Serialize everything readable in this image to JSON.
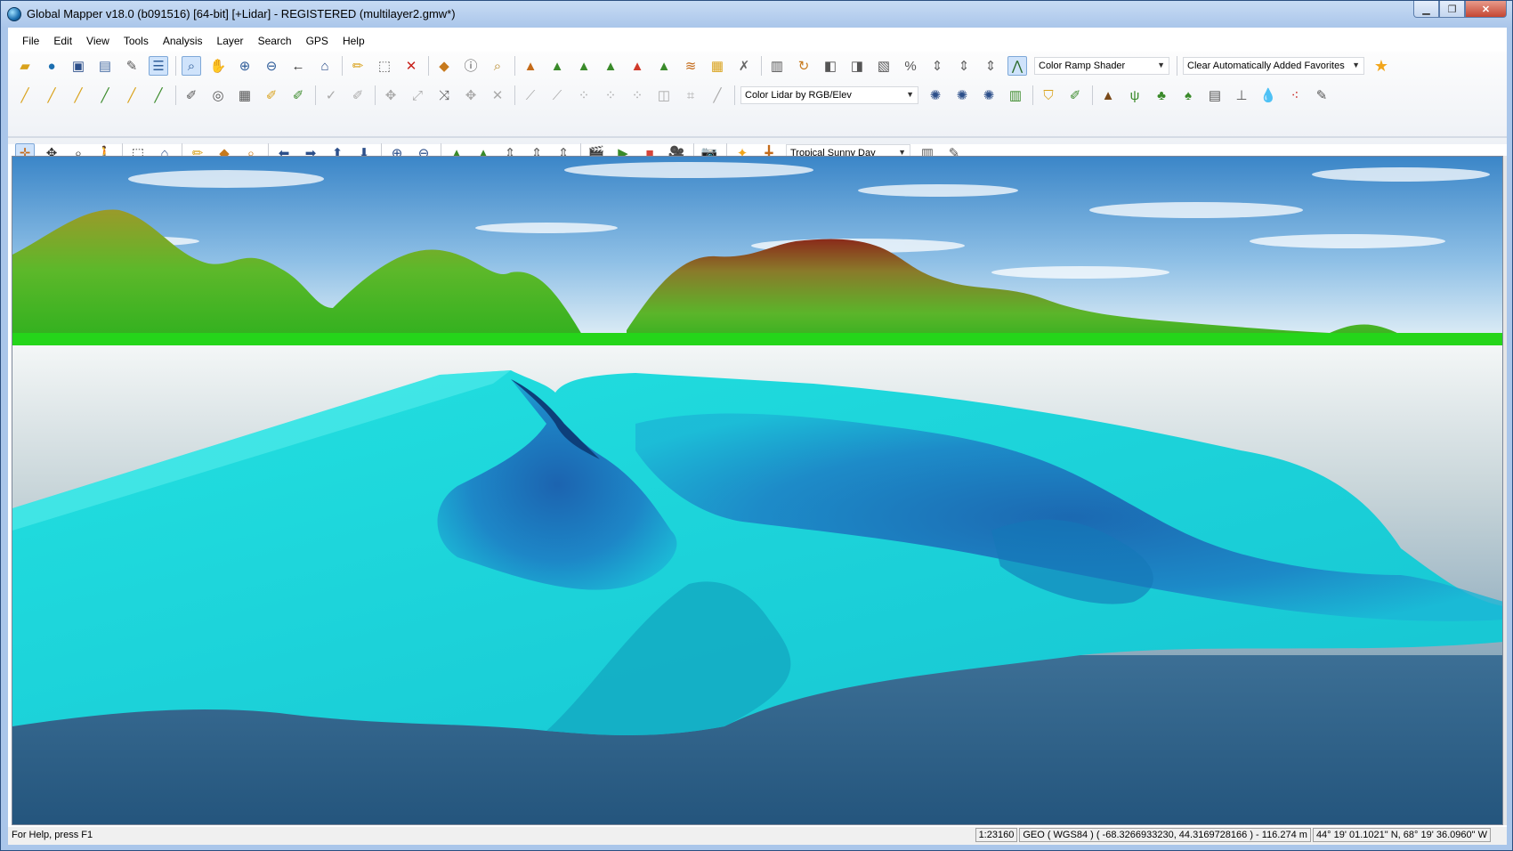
{
  "window": {
    "title": "Global Mapper v18.0 (b091516) [64-bit] [+Lidar] - REGISTERED (multilayer2.gmw*)",
    "controls": {
      "minimize": "▁",
      "maximize": "❐",
      "close": "✕"
    }
  },
  "menubar": {
    "items": [
      "File",
      "Edit",
      "View",
      "Tools",
      "Analysis",
      "Layer",
      "Search",
      "GPS",
      "Help"
    ]
  },
  "toolbar": {
    "shader_dropdown": "Color Ramp Shader",
    "favorites_dropdown": "Clear Automatically Added Favorites",
    "lidar_color_dropdown": "Color Lidar by RGB/Elev",
    "sky_dropdown": "Tropical Sunny Day",
    "row1_icons": [
      "open-folder-icon",
      "globe-icon",
      "save-icon",
      "print-icon",
      "wrench-icon",
      "layers-icon",
      "zoom-box-icon",
      "pan-hand-icon",
      "zoom-in-icon",
      "zoom-out-icon",
      "back-icon",
      "home-icon",
      "digitizer-icon",
      "select-box-icon",
      "delete-icon",
      "measure-icon",
      "info-icon",
      "search-icon",
      "terrain-1-icon",
      "terrain-2-icon",
      "terrain-3-icon",
      "terrain-4-icon",
      "terrain-5-icon",
      "terrain-6-icon",
      "contour-icon",
      "raster-icon",
      "tools-x-icon",
      "layout-icon",
      "rotate-icon",
      "split-icon",
      "view3d-icon",
      "3d-icon",
      "percent-icon",
      "elev-icon",
      "elev2-icon",
      "elev3-icon",
      "shader-active-icon",
      "star-icon"
    ],
    "row2_icons": [
      "line-1-icon",
      "line-2-icon",
      "line-3-icon",
      "line-4-icon",
      "line-5-icon",
      "line-6-icon",
      "edit-1-icon",
      "target-icon",
      "grid-icon",
      "edit-2-icon",
      "edit-3-icon",
      "check-icon",
      "edit-4-icon",
      "move-1-icon",
      "move-2-icon",
      "move-3-icon",
      "move-4-icon",
      "move-5-icon",
      "path-1-icon",
      "path-2-icon",
      "path-3-icon",
      "path-4-icon",
      "path-5-icon",
      "path-6-icon",
      "crop-icon",
      "ruler-icon",
      "gear-1-icon",
      "gear-2-icon",
      "gear-3-icon",
      "chart-icon",
      "filter-icon",
      "edit-5-icon",
      "mountain-icon",
      "grass-icon",
      "shrub-icon",
      "tree-icon",
      "building-icon",
      "powerline-icon",
      "water-icon",
      "points-icon",
      "brush-icon"
    ],
    "row3_icons": [
      "cursor-icon",
      "pan-icon",
      "magnify-icon",
      "walk-icon",
      "cube-icon",
      "home-icon",
      "pencil-icon",
      "ruler-icon",
      "magnet-icon",
      "arrow-left-icon",
      "arrow-right-icon",
      "arrow-up-icon",
      "arrow-down-icon",
      "zoom-in-icon",
      "zoom-out-icon",
      "terrain-up-icon",
      "terrain-down-icon",
      "height-up-icon",
      "height-down-icon",
      "height-reset-icon",
      "clapper-icon",
      "play-icon",
      "stop-icon",
      "video-camera-icon",
      "camera-icon",
      "sun-icon",
      "crosshair-icon",
      "layout-icon",
      "wrench-icon"
    ]
  },
  "view3d": {
    "sky_top": "#3b86c8",
    "sky_bottom": "#cfe6f6",
    "water": "#2d5d85",
    "terrain_green": "#34a820",
    "terrain_cyan": "#1dd6d8",
    "terrain_blue": "#1a6fbf"
  },
  "statusbar": {
    "help": "For Help, press F1",
    "scale": "1:23160",
    "coords": "GEO ( WGS84 ) ( -68.3266933230, 44.3169728166 ) - 116.274 m",
    "dms": "44° 19' 01.1021\" N, 68° 19' 36.0960\" W"
  }
}
